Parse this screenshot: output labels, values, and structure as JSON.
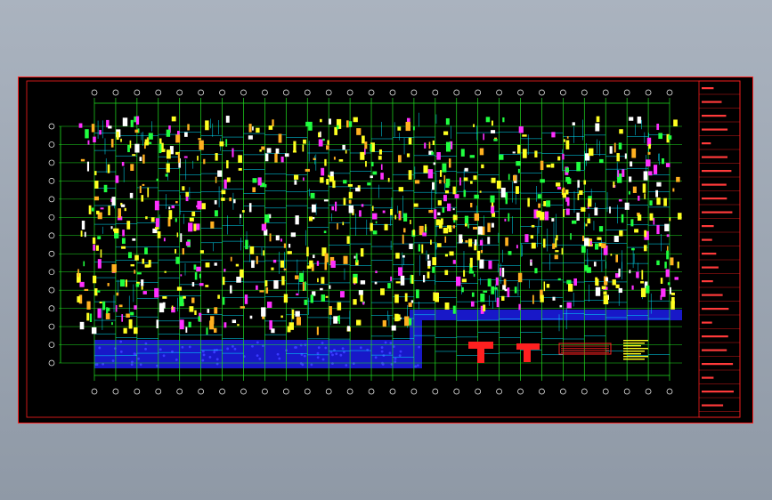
{
  "drawing": {
    "description_visible_text": "",
    "title_block": {
      "sheet_no": "",
      "rows": 24
    },
    "grid_axes_top_count": 28,
    "grid_axes_left_count": 14,
    "colors": {
      "background": "#000000",
      "frame": "#ff2020",
      "grid": "#20e020",
      "beams": "#00e5ff",
      "annotation_yellow": "#ffff20",
      "annotation_magenta": "#ff30ff",
      "hatch_blue": "#1818c8",
      "title_block_text": "#ff3a3a",
      "window_bg": "#9aa4b1"
    }
  }
}
